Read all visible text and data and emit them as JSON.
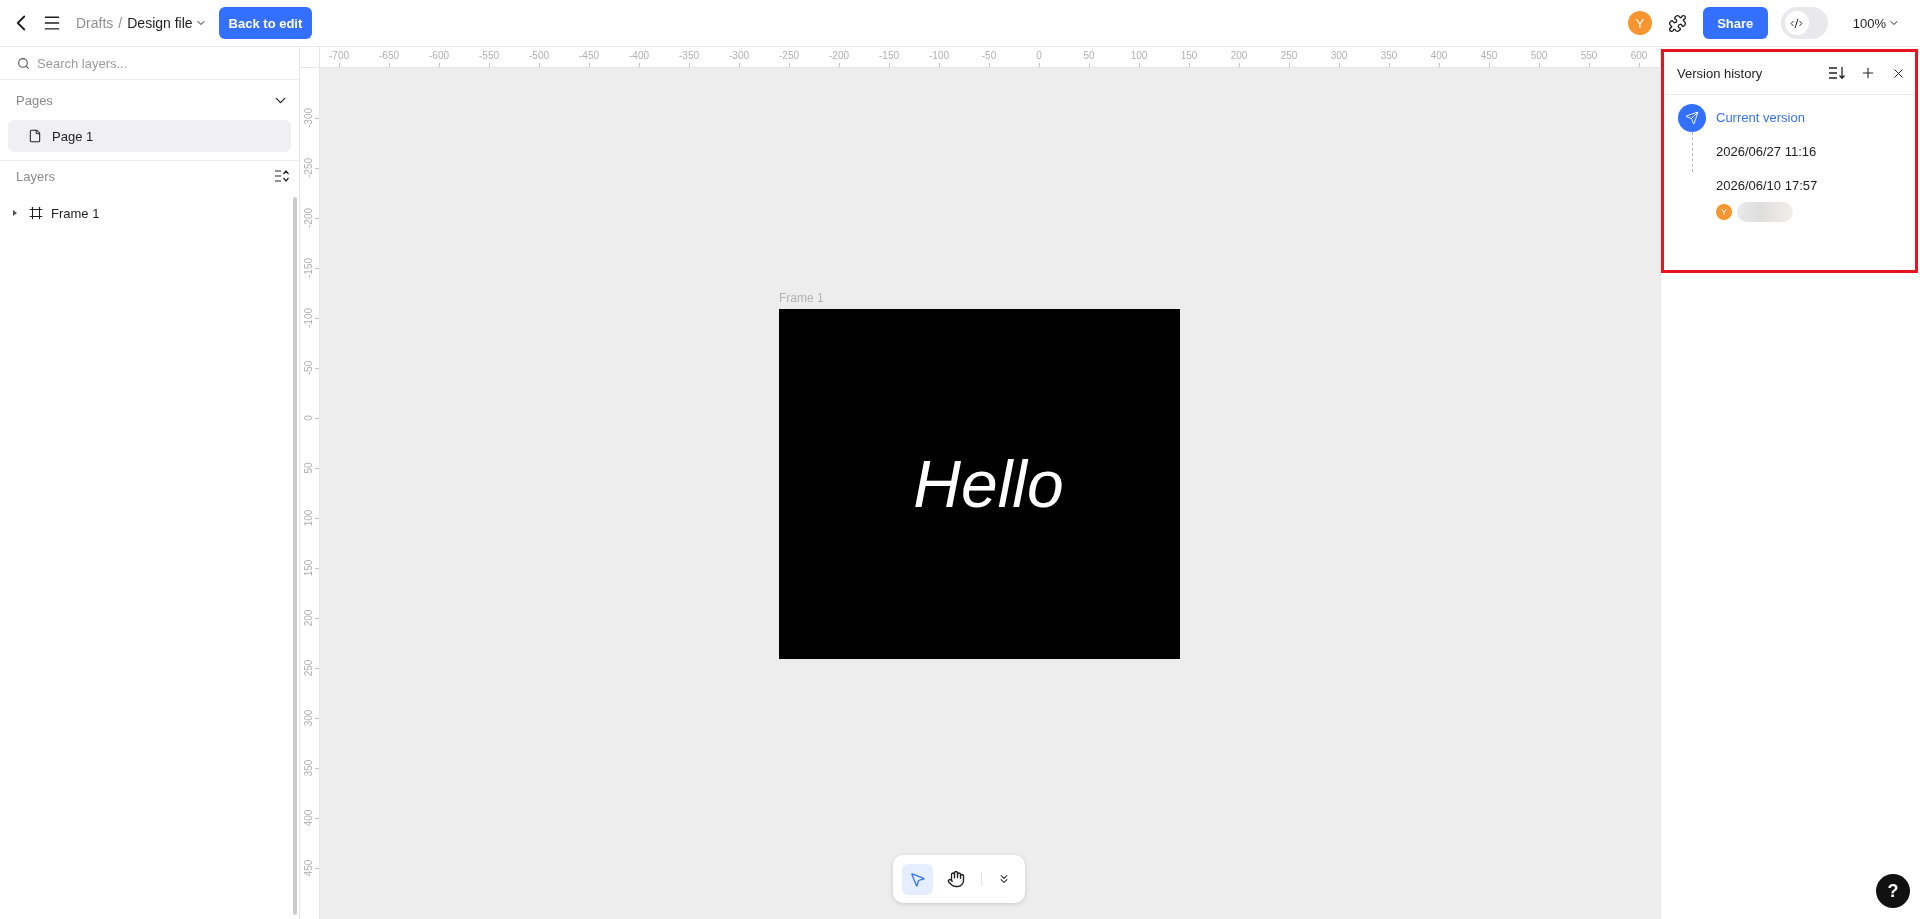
{
  "header": {
    "breadcrumb": {
      "parent": "Drafts",
      "separator": "/",
      "current": "Design file"
    },
    "back_to_edit": "Back to edit",
    "avatar": "Y",
    "share": "Share",
    "code_toggle": {
      "on": false
    },
    "zoom": "100%"
  },
  "sidebar": {
    "search": {
      "placeholder": "Search layers..."
    },
    "pages": {
      "title": "Pages",
      "expanded": true,
      "items": [
        {
          "label": "Page 1",
          "selected": true
        }
      ]
    },
    "layers": {
      "title": "Layers",
      "items": [
        {
          "label": "Frame 1",
          "kind": "frame",
          "expanded": false
        }
      ]
    }
  },
  "rulers": {
    "horizontal": [
      "-700",
      "-650",
      "-600",
      "-550",
      "-500",
      "-450",
      "-400",
      "-350",
      "-300",
      "-250",
      "-200",
      "-150",
      "-100",
      "-50",
      "0",
      "50",
      "100",
      "150",
      "200",
      "250",
      "300",
      "350",
      "400",
      "450",
      "500",
      "550",
      "600"
    ],
    "vertical": [
      "-300",
      "-250",
      "-200",
      "-150",
      "-100",
      "-50",
      "0",
      "50",
      "100",
      "150",
      "200",
      "250",
      "300",
      "350",
      "400",
      "450"
    ]
  },
  "canvas": {
    "frame": {
      "label": "Frame 1",
      "text": "Hello"
    },
    "tools": [
      {
        "kind": "select",
        "selected": true
      },
      {
        "kind": "hand",
        "selected": false
      }
    ]
  },
  "version_history": {
    "title": "Version history",
    "highlighted": true,
    "entries": [
      {
        "kind": "current",
        "label": "Current version"
      },
      {
        "kind": "saved",
        "label": "2026/06/27 11:16"
      },
      {
        "kind": "saved",
        "label": "2026/06/10 17:57",
        "author": {
          "initial": "Y"
        }
      }
    ]
  },
  "help": {
    "label": "?"
  }
}
